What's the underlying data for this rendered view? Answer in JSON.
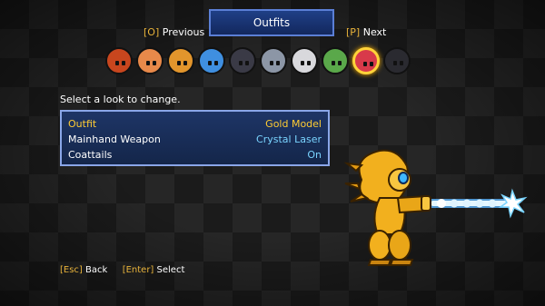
{
  "header": {
    "title": "Outfits",
    "prev": {
      "key": "[O]",
      "label": "Previous"
    },
    "next": {
      "key": "[P]",
      "label": "Next"
    }
  },
  "portraits": [
    {
      "icon": "red-spiky-hair-portrait-icon",
      "color": "#c8461e",
      "selected": false
    },
    {
      "icon": "orange-hair-portrait-icon",
      "color": "#e8894a",
      "selected": false
    },
    {
      "icon": "fox-portrait-icon",
      "color": "#e2952c",
      "selected": false
    },
    {
      "icon": "blue-bird-portrait-icon",
      "color": "#3f8fe0",
      "selected": false
    },
    {
      "icon": "dark-helmet-portrait-icon",
      "color": "#3a3a46",
      "selected": false
    },
    {
      "icon": "gray-hood-portrait-icon",
      "color": "#8c96a6",
      "selected": false
    },
    {
      "icon": "white-mask-portrait-icon",
      "color": "#d8d8dc",
      "selected": false
    },
    {
      "icon": "green-hair-portrait-icon",
      "color": "#5aa84a",
      "selected": false
    },
    {
      "icon": "red-robot-portrait-icon",
      "color": "#d83a4a",
      "selected": true
    },
    {
      "icon": "black-red-portrait-icon",
      "color": "#2a2a30",
      "selected": false
    }
  ],
  "prompt": "Select a look to change.",
  "options": [
    {
      "label": "Outfit",
      "value": "Gold Model",
      "active": true
    },
    {
      "label": "Mainhand Weapon",
      "value": "Crystal Laser",
      "active": false
    },
    {
      "label": "Coattails",
      "value": "On",
      "active": false
    }
  ],
  "footer": {
    "back_key": "[Esc]",
    "back_label": "Back",
    "select_key": "[Enter]",
    "select_label": "Select"
  },
  "colors": {
    "accent": "#ffcc33",
    "value": "#7ad4ff",
    "panel": "#1e3566",
    "gold": "#f2b01e",
    "laser": "#8fd8ff"
  }
}
